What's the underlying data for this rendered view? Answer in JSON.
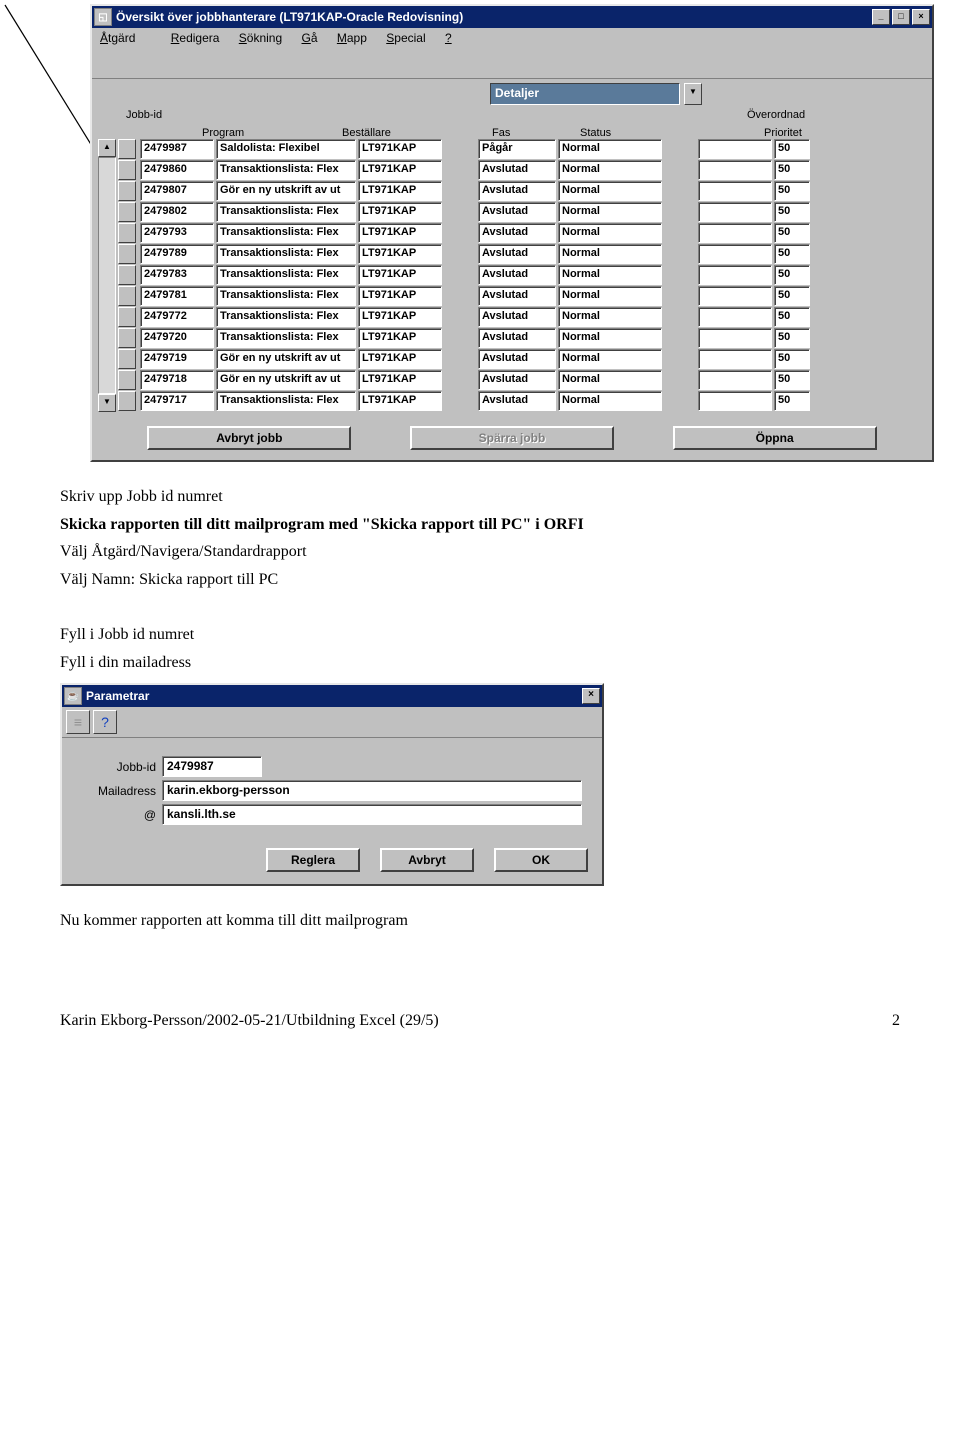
{
  "window1": {
    "title": "Översikt över jobbhanterare (LT971KAP-Oracle Redovisning)",
    "menu": [
      "Åtgärd",
      "Redigera",
      "Sökning",
      "Gå",
      "Mapp",
      "Special",
      "?"
    ],
    "detaljer_label": "Detaljer",
    "jobid_header": "Jobb-id",
    "overordnad_header": "Överordnad",
    "columns": {
      "program": "Program",
      "bestallare": "Beställare",
      "fas": "Fas",
      "status": "Status",
      "prioritet": "Prioritet"
    },
    "rows": [
      {
        "id": "2479987",
        "program": "Saldolista: Flexibel",
        "best": "LT971KAP",
        "fas": "Pågår",
        "status": "Normal",
        "over": "",
        "prio": "50"
      },
      {
        "id": "2479860",
        "program": "Transaktionslista: Flex",
        "best": "LT971KAP",
        "fas": "Avslutad",
        "status": "Normal",
        "over": "",
        "prio": "50"
      },
      {
        "id": "2479807",
        "program": "Gör en ny utskrift av ut",
        "best": "LT971KAP",
        "fas": "Avslutad",
        "status": "Normal",
        "over": "",
        "prio": "50"
      },
      {
        "id": "2479802",
        "program": "Transaktionslista: Flex",
        "best": "LT971KAP",
        "fas": "Avslutad",
        "status": "Normal",
        "over": "",
        "prio": "50"
      },
      {
        "id": "2479793",
        "program": "Transaktionslista: Flex",
        "best": "LT971KAP",
        "fas": "Avslutad",
        "status": "Normal",
        "over": "",
        "prio": "50"
      },
      {
        "id": "2479789",
        "program": "Transaktionslista: Flex",
        "best": "LT971KAP",
        "fas": "Avslutad",
        "status": "Normal",
        "over": "",
        "prio": "50"
      },
      {
        "id": "2479783",
        "program": "Transaktionslista: Flex",
        "best": "LT971KAP",
        "fas": "Avslutad",
        "status": "Normal",
        "over": "",
        "prio": "50"
      },
      {
        "id": "2479781",
        "program": "Transaktionslista: Flex",
        "best": "LT971KAP",
        "fas": "Avslutad",
        "status": "Normal",
        "over": "",
        "prio": "50"
      },
      {
        "id": "2479772",
        "program": "Transaktionslista: Flex",
        "best": "LT971KAP",
        "fas": "Avslutad",
        "status": "Normal",
        "over": "",
        "prio": "50"
      },
      {
        "id": "2479720",
        "program": "Transaktionslista: Flex",
        "best": "LT971KAP",
        "fas": "Avslutad",
        "status": "Normal",
        "over": "",
        "prio": "50"
      },
      {
        "id": "2479719",
        "program": "Gör en ny utskrift av ut",
        "best": "LT971KAP",
        "fas": "Avslutad",
        "status": "Normal",
        "over": "",
        "prio": "50"
      },
      {
        "id": "2479718",
        "program": "Gör en ny utskrift av ut",
        "best": "LT971KAP",
        "fas": "Avslutad",
        "status": "Normal",
        "over": "",
        "prio": "50"
      },
      {
        "id": "2479717",
        "program": "Transaktionslista: Flex",
        "best": "LT971KAP",
        "fas": "Avslutad",
        "status": "Normal",
        "over": "",
        "prio": "50"
      }
    ],
    "buttons": {
      "cancel": "Avbryt jobb",
      "lock": "Spärra jobb",
      "open": "Öppna"
    }
  },
  "text": {
    "l1": "Skriv upp Jobb id numret",
    "l2": "Skicka rapporten till ditt mailprogram med \"Skicka rapport till PC\" i ORFI",
    "l3": "Välj Åtgärd/Navigera/Standardrapport",
    "l4": "Välj Namn: Skicka rapport till PC",
    "l5": "Fyll i  Jobb id numret",
    "l6": "Fyll i din mailadress",
    "l7": "Nu kommer rapporten att komma till ditt mailprogram"
  },
  "window2": {
    "title": "Parametrar",
    "labels": {
      "jobid": "Jobb-id",
      "mail": "Mailadress",
      "at": "@"
    },
    "values": {
      "jobid": "2479987",
      "mail": "karin.ekborg-persson",
      "at": "kansli.lth.se"
    },
    "buttons": {
      "reglera": "Reglera",
      "avbryt": "Avbryt",
      "ok": "OK"
    }
  },
  "footer": {
    "left": "Karin Ekborg-Persson/2002-05-21/Utbildning Excel (29/5)",
    "right": "2"
  }
}
